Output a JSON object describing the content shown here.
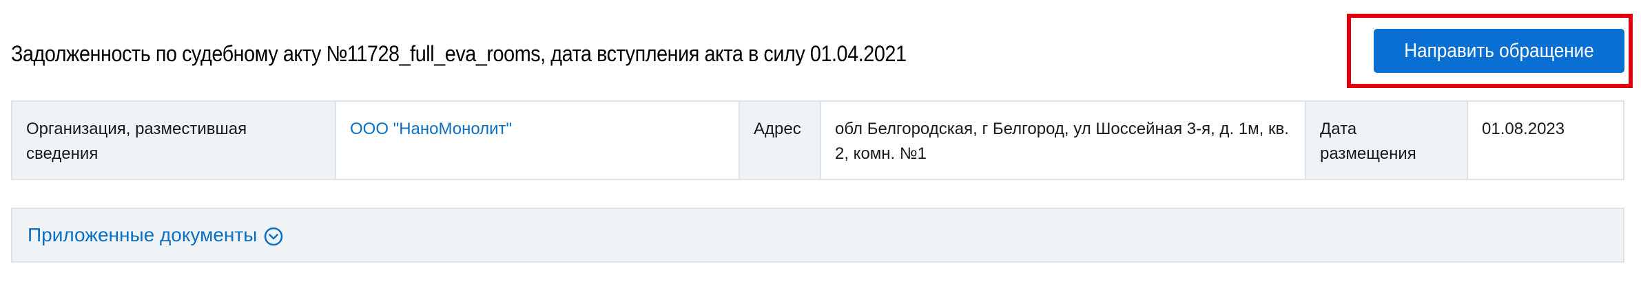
{
  "header": {
    "title": "Задолженность по судебному акту №11728_full_eva_rooms, дата вступления акта в силу 01.04.2021",
    "action_button_label": "Направить обращение"
  },
  "info_table": {
    "organization_label": "Организация, разместившая сведения",
    "organization_value": "ООО \"НаноМонолит\"",
    "address_label": "Адрес",
    "address_value": "обл Белгородская, г Белгород, ул Шоссейная 3-я, д. 1м, кв. 2, комн. №1",
    "date_label": "Дата размещения",
    "date_value": "01.08.2023"
  },
  "documents": {
    "label": "Приложенные документы",
    "toggle_icon": "chevron-down-circle-icon"
  },
  "colors": {
    "accent": "#0a6fd2",
    "link": "#0a6fc2",
    "highlight": "#e0000f",
    "label_bg": "#eff3f6",
    "border": "#dde3e9"
  }
}
